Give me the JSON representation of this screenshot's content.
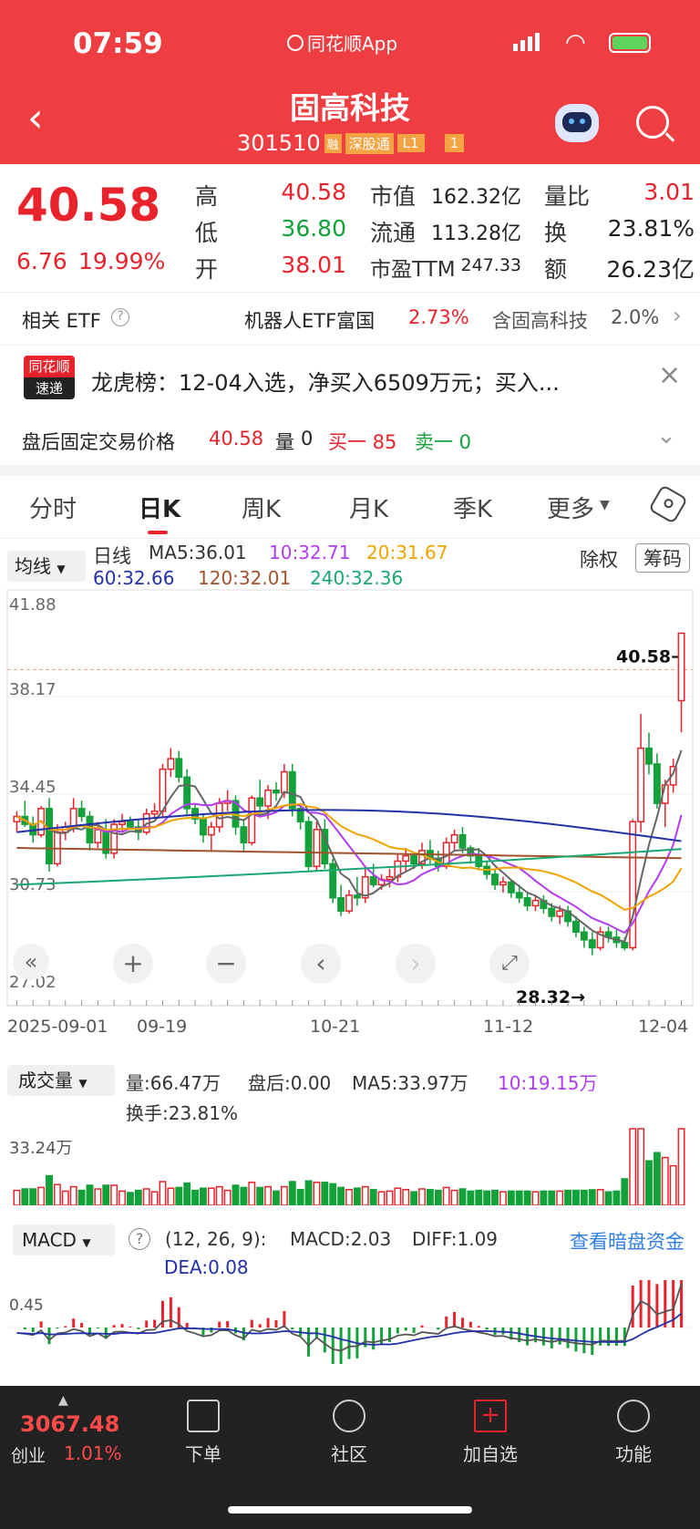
{
  "status": {
    "time": "07:59",
    "app_label": "同花顺App"
  },
  "header": {
    "title": "固高科技",
    "code": "301510",
    "badges": [
      "融",
      "深股通",
      "L1",
      "1"
    ]
  },
  "quote": {
    "price": "40.58",
    "change": "6.76",
    "change_pct": "19.99%",
    "fields": [
      {
        "label": "高",
        "value": "40.58"
      },
      {
        "label": "低",
        "value": "36.80"
      },
      {
        "label": "开",
        "value": "38.01"
      },
      {
        "label": "市值",
        "value": "162.32亿"
      },
      {
        "label": "流通",
        "value": "113.28亿"
      },
      {
        "label": "市盈TTM",
        "value": "247.33"
      },
      {
        "label": "量比",
        "value": "3.01"
      },
      {
        "label": "换",
        "value": "23.81%"
      },
      {
        "label": "额",
        "value": "26.23亿"
      }
    ]
  },
  "etf": {
    "label": "相关 ETF",
    "name": "机器人ETF富国",
    "pct": "2.73%",
    "holding": "含固高科技",
    "holding_pct": "2.0%"
  },
  "news": {
    "badge_top": "同花顺",
    "badge_bottom": "速递",
    "text": "龙虎榜：12-04入选，净买入6509万元；买入..."
  },
  "after_hours": {
    "label": "盘后固定交易价格",
    "price": "40.58",
    "vol_label": "量",
    "vol": "0",
    "buy": "买一 85",
    "sell": "卖一 0"
  },
  "tabs": [
    "分时",
    "日K",
    "周K",
    "月K",
    "季K",
    "更多"
  ],
  "indicator": {
    "ma_button": "均线",
    "line_type": "日线",
    "ma5": "MA5:36.01",
    "ma10": "10:32.71",
    "ma20": "20:31.67",
    "ma60": "60:32.66",
    "ma120": "120:32.01",
    "ma240": "240:32.36",
    "fq": "除权",
    "chip": "筹码"
  },
  "chart_data": {
    "type": "candlestick",
    "y_ticks": [
      "41.88",
      "38.17",
      "34.45",
      "30.73",
      "27.02"
    ],
    "x_ticks": [
      "2025-09-01",
      "09-19",
      "10-21",
      "11-12",
      "12-04"
    ],
    "high_label": "40.58→",
    "low_label": "28.32→",
    "candles": [
      [
        33.4,
        33.8,
        33.0,
        33.6
      ],
      [
        33.6,
        34.2,
        33.2,
        33.3
      ],
      [
        33.3,
        33.6,
        32.6,
        32.9
      ],
      [
        32.9,
        34.0,
        32.8,
        33.9
      ],
      [
        33.9,
        34.3,
        31.5,
        31.8
      ],
      [
        31.8,
        33.3,
        31.7,
        33.0
      ],
      [
        33.0,
        33.4,
        32.7,
        33.2
      ],
      [
        33.2,
        34.3,
        33.0,
        33.9
      ],
      [
        33.9,
        34.2,
        33.4,
        33.6
      ],
      [
        33.6,
        33.8,
        32.3,
        32.6
      ],
      [
        32.6,
        33.4,
        32.4,
        33.1
      ],
      [
        33.1,
        33.5,
        32.0,
        32.2
      ],
      [
        32.2,
        33.5,
        32.0,
        33.3
      ],
      [
        33.3,
        33.7,
        33.0,
        33.4
      ],
      [
        33.4,
        33.6,
        33.1,
        33.2
      ],
      [
        33.2,
        33.5,
        32.7,
        33.0
      ],
      [
        33.0,
        33.9,
        32.9,
        33.7
      ],
      [
        33.7,
        34.1,
        33.5,
        33.8
      ],
      [
        33.8,
        35.6,
        33.6,
        35.4
      ],
      [
        35.4,
        36.2,
        35.1,
        35.8
      ],
      [
        35.8,
        36.1,
        34.9,
        35.1
      ],
      [
        35.1,
        35.4,
        33.6,
        33.9
      ],
      [
        33.9,
        34.1,
        33.3,
        33.5
      ],
      [
        33.5,
        33.7,
        32.6,
        32.9
      ],
      [
        32.9,
        33.4,
        32.3,
        33.2
      ],
      [
        33.2,
        34.3,
        33.0,
        34.1
      ],
      [
        34.1,
        34.6,
        33.8,
        34.2
      ],
      [
        34.2,
        34.4,
        32.9,
        33.2
      ],
      [
        33.2,
        33.5,
        32.3,
        32.6
      ],
      [
        32.6,
        34.4,
        32.5,
        34.3
      ],
      [
        34.3,
        35.0,
        33.8,
        34.0
      ],
      [
        34.0,
        34.8,
        33.5,
        34.6
      ],
      [
        34.6,
        34.9,
        34.2,
        34.5
      ],
      [
        34.5,
        35.6,
        34.3,
        35.3
      ],
      [
        35.3,
        35.6,
        33.6,
        33.9
      ],
      [
        33.9,
        34.0,
        33.1,
        33.4
      ],
      [
        33.4,
        33.6,
        31.5,
        31.7
      ],
      [
        31.7,
        33.4,
        31.5,
        33.1
      ],
      [
        33.1,
        33.5,
        31.6,
        31.8
      ],
      [
        31.8,
        32.0,
        30.3,
        30.5
      ],
      [
        30.5,
        31.0,
        29.8,
        30.0
      ],
      [
        30.0,
        30.8,
        29.9,
        30.6
      ],
      [
        30.6,
        31.3,
        30.2,
        30.5
      ],
      [
        30.5,
        31.6,
        30.3,
        31.3
      ],
      [
        31.3,
        31.8,
        30.9,
        31.0
      ],
      [
        31.0,
        31.4,
        30.8,
        31.2
      ],
      [
        31.2,
        31.6,
        30.9,
        31.3
      ],
      [
        31.3,
        32.2,
        31.1,
        31.9
      ],
      [
        31.9,
        32.4,
        31.5,
        32.1
      ],
      [
        32.1,
        32.2,
        31.6,
        31.8
      ],
      [
        31.8,
        32.6,
        31.6,
        32.3
      ],
      [
        32.3,
        32.7,
        31.8,
        32.0
      ],
      [
        32.0,
        32.3,
        31.5,
        31.7
      ],
      [
        31.7,
        32.8,
        31.6,
        32.6
      ],
      [
        32.6,
        33.1,
        32.3,
        32.9
      ],
      [
        32.9,
        33.2,
        32.2,
        32.4
      ],
      [
        32.4,
        32.5,
        31.8,
        32.1
      ],
      [
        32.1,
        32.4,
        31.6,
        31.7
      ],
      [
        31.7,
        31.9,
        31.2,
        31.4
      ],
      [
        31.4,
        31.6,
        30.8,
        31.0
      ],
      [
        31.0,
        31.3,
        30.7,
        31.1
      ],
      [
        31.1,
        31.2,
        30.5,
        30.7
      ],
      [
        30.7,
        31.0,
        30.3,
        30.5
      ],
      [
        30.5,
        30.7,
        30.0,
        30.2
      ],
      [
        30.2,
        30.6,
        30.0,
        30.4
      ],
      [
        30.4,
        30.6,
        29.9,
        30.1
      ],
      [
        30.1,
        30.3,
        29.6,
        29.8
      ],
      [
        29.8,
        30.2,
        29.5,
        30.0
      ],
      [
        30.0,
        30.2,
        29.4,
        29.6
      ],
      [
        29.6,
        29.8,
        29.0,
        29.2
      ],
      [
        29.2,
        29.4,
        28.6,
        28.9
      ],
      [
        28.9,
        29.2,
        28.32,
        28.6
      ],
      [
        28.6,
        29.4,
        28.5,
        29.2
      ],
      [
        29.2,
        29.4,
        28.8,
        29.0
      ],
      [
        29.0,
        29.3,
        28.6,
        28.8
      ],
      [
        28.8,
        29.0,
        28.5,
        28.6
      ],
      [
        28.6,
        33.5,
        28.5,
        33.4
      ],
      [
        33.4,
        37.5,
        33.0,
        36.2
      ],
      [
        36.2,
        36.8,
        35.2,
        35.6
      ],
      [
        35.6,
        36.0,
        33.9,
        34.1
      ],
      [
        34.1,
        35.0,
        33.2,
        34.8
      ],
      [
        34.8,
        35.8,
        34.5,
        35.5
      ],
      [
        38.01,
        40.58,
        36.8,
        40.58
      ]
    ]
  },
  "volume": {
    "button": "成交量",
    "vol": "量:66.47万",
    "after": "盘后:0.00",
    "ma5": "MA5:33.97万",
    "ma10": "10:19.15万",
    "turnover": "换手:23.81%",
    "axis_label": "33.24万"
  },
  "macd": {
    "button": "MACD",
    "params": "(12, 26, 9):",
    "macd": "MACD:2.03",
    "diff": "DIFF:1.09",
    "dea": "DEA:0.08",
    "link": "查看暗盘资金",
    "axis_label": "0.45"
  },
  "bottom": {
    "index_value": "3067.48",
    "index_name": "创业",
    "index_pct": "1.01%",
    "items": [
      "下单",
      "社区",
      "加自选",
      "功能"
    ]
  }
}
